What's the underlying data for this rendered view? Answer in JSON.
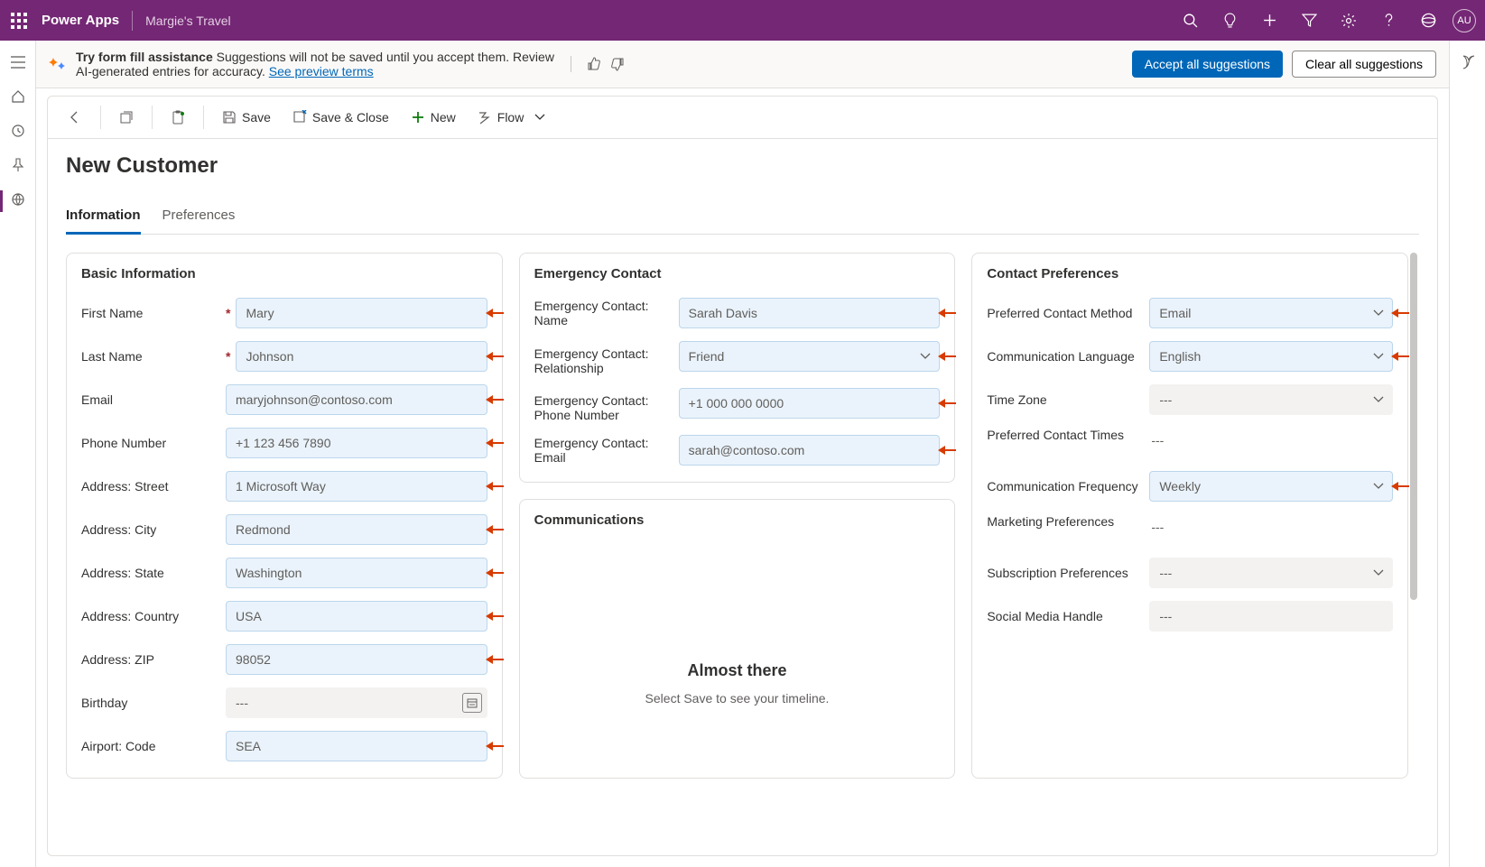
{
  "topbar": {
    "app_title": "Power Apps",
    "model_app_name": "Margie's Travel",
    "avatar_initials": "AU"
  },
  "infobar": {
    "bold": "Try form fill assistance",
    "msg": " Suggestions will not be saved until you accept them. Review AI-generated entries for accuracy. ",
    "link": "See preview terms",
    "accept_btn": "Accept all suggestions",
    "clear_btn": "Clear all suggestions"
  },
  "cmdbar": {
    "save": "Save",
    "save_close": "Save & Close",
    "new": "New",
    "flow": "Flow"
  },
  "page": {
    "title": "New Customer",
    "tabs": [
      "Information",
      "Preferences"
    ]
  },
  "basic": {
    "title": "Basic Information",
    "fields": {
      "first_name": {
        "label": "First Name",
        "value": "Mary",
        "required": true,
        "arrow": true
      },
      "last_name": {
        "label": "Last Name",
        "value": "Johnson",
        "required": true,
        "arrow": true
      },
      "email": {
        "label": "Email",
        "value": "maryjohnson@contoso.com",
        "arrow": true
      },
      "phone": {
        "label": "Phone Number",
        "value": "+1 123 456 7890",
        "arrow": true
      },
      "street": {
        "label": "Address: Street",
        "value": "1 Microsoft Way",
        "arrow": true
      },
      "city": {
        "label": "Address: City",
        "value": "Redmond",
        "arrow": true
      },
      "state": {
        "label": "Address: State",
        "value": "Washington",
        "arrow": true
      },
      "country": {
        "label": "Address: Country",
        "value": "USA",
        "arrow": true
      },
      "zip": {
        "label": "Address: ZIP",
        "value": "98052",
        "arrow": true
      },
      "birthday": {
        "label": "Birthday",
        "value": "---",
        "gray": true,
        "calendar": true
      },
      "airport": {
        "label": "Airport: Code",
        "value": "SEA",
        "arrow": true
      }
    }
  },
  "emergency": {
    "title": "Emergency Contact",
    "fields": {
      "name": {
        "label": "Emergency Contact: Name",
        "value": "Sarah Davis",
        "arrow": true
      },
      "relationship": {
        "label": "Emergency Contact: Relationship",
        "value": "Friend",
        "arrow": true,
        "dropdown": true
      },
      "phone": {
        "label": "Emergency Contact: Phone Number",
        "value": "+1 000 000 0000",
        "arrow": true
      },
      "email": {
        "label": "Emergency Contact: Email",
        "value": "sarah@contoso.com",
        "arrow": true
      }
    }
  },
  "communications": {
    "title": "Communications",
    "empty_title": "Almost there",
    "empty_msg": "Select Save to see your timeline."
  },
  "prefs": {
    "title": "Contact Preferences",
    "fields": {
      "method": {
        "label": "Preferred Contact Method",
        "value": "Email",
        "arrow": true,
        "dropdown": true,
        "suggested": true
      },
      "lang": {
        "label": "Communication Language",
        "value": "English",
        "arrow": true,
        "dropdown": true,
        "suggested": true
      },
      "tz": {
        "label": "Time Zone",
        "value": "---",
        "dropdown": true,
        "gray": true
      },
      "times": {
        "label": "Preferred Contact Times",
        "value": "---",
        "static": true
      },
      "freq": {
        "label": "Communication Frequency",
        "value": "Weekly",
        "arrow": true,
        "dropdown": true,
        "suggested": true
      },
      "marketing": {
        "label": "Marketing Preferences",
        "value": "---",
        "static": true
      },
      "sub": {
        "label": "Subscription Preferences",
        "value": "---",
        "dropdown": true,
        "gray": true
      },
      "social": {
        "label": "Social Media Handle",
        "value": "---",
        "gray": true
      }
    }
  }
}
